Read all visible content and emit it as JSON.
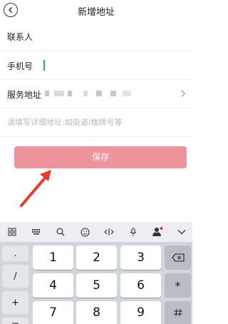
{
  "header": {
    "title": "新增地址"
  },
  "form": {
    "contact_label": "联系人",
    "phone_label": "手机号",
    "region_label": "服务地址",
    "detail_placeholder": "请填写详细地址:如街道/楼牌号等"
  },
  "save_label": "保存",
  "keyboard": {
    "side_keys": [
      ".",
      "/",
      "+",
      "−"
    ],
    "digits": [
      "1",
      "2",
      "3",
      "4",
      "5",
      "6",
      "7",
      "8",
      "9"
    ],
    "star_label": "*",
    "toolbar_icons": [
      "grid-icon",
      "keyboard-icon",
      "search-icon",
      "emoji-icon",
      "cursor-move-icon",
      "microphone-icon",
      "avatar-icon",
      "collapse-icon"
    ]
  },
  "colors": {
    "accent": "#2aa389",
    "save_button": "#ed939c",
    "annotation_arrow": "#e83a2a",
    "keyboard_bg": "#d2d5db",
    "notification_dot": "#e53935"
  }
}
